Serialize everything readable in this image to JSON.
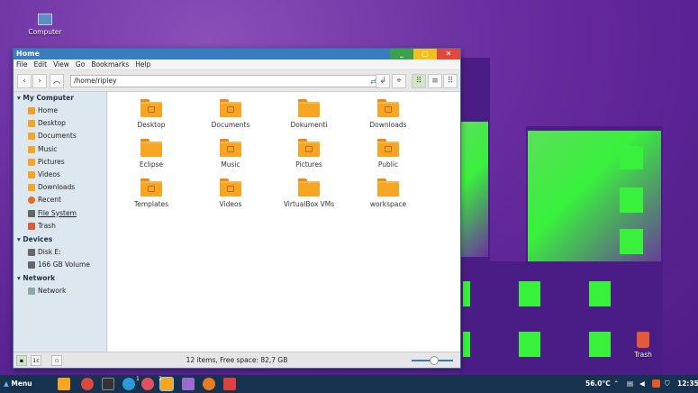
{
  "desktop": {
    "icons": [
      {
        "label": "Computer",
        "icon": "computer-icon"
      },
      {
        "label": "Trash",
        "icon": "trash-icon"
      }
    ]
  },
  "window": {
    "title": "Home",
    "controls": {
      "minimize": "_",
      "maximize": "▢",
      "close": "✕"
    },
    "menu": [
      "File",
      "Edit",
      "View",
      "Go",
      "Bookmarks",
      "Help"
    ],
    "address": "/home/ripley",
    "sidebar": {
      "sections": [
        {
          "title": "My Computer",
          "items": [
            "Home",
            "Desktop",
            "Documents",
            "Music",
            "Pictures",
            "Videos",
            "Downloads",
            "Recent",
            "File System",
            "Trash"
          ]
        },
        {
          "title": "Devices",
          "items": [
            "Disk E:",
            "166 GB Volume"
          ]
        },
        {
          "title": "Network",
          "items": [
            "Network"
          ]
        }
      ]
    },
    "files": [
      "Desktop",
      "Documents",
      "Dokumenti",
      "Downloads",
      "Eclipse",
      "Music",
      "Pictures",
      "Public",
      "Templates",
      "Videos",
      "VirtualBox VMs",
      "workspace"
    ],
    "status": "12 items, Free space: 82,7 GB",
    "status_buttons": [
      "1c"
    ]
  },
  "taskbar": {
    "menu_label": "Menu",
    "temperature": "56.0°C",
    "clock": "12:35",
    "badges": [
      "1",
      "3"
    ]
  },
  "colors": {
    "accent": "#3a7cc0",
    "folder": "#f6a623",
    "sidebar": "#dde7f0",
    "taskbar": "#17324f",
    "desktop_green": "#39f03c",
    "desktop_purple": "#5a2292"
  }
}
